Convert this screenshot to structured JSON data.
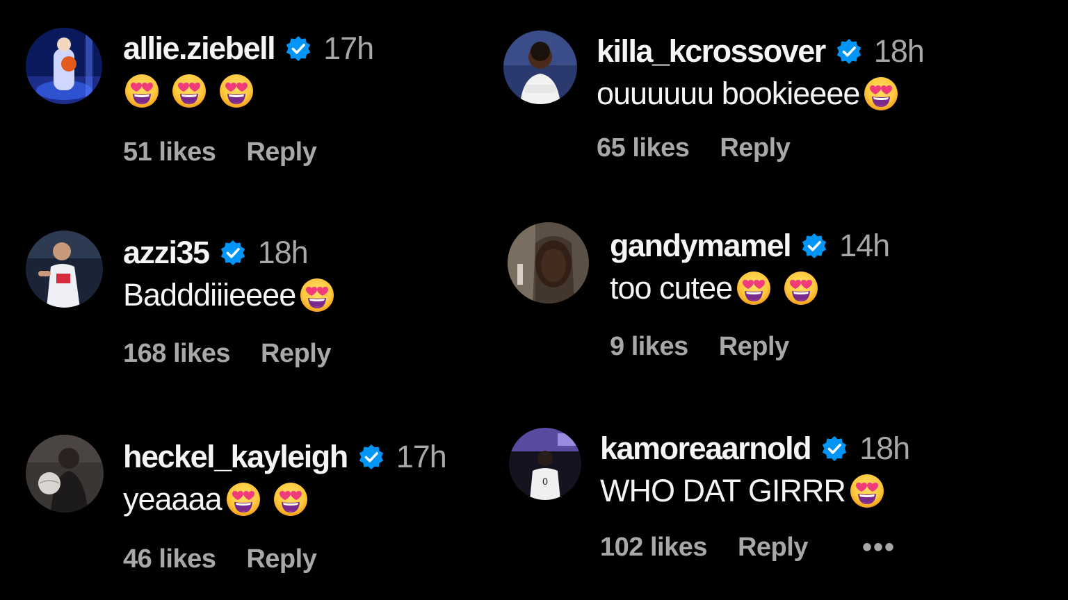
{
  "colors": {
    "background": "#000000",
    "username": "#f5f5f5",
    "muted": "#a8a8a8",
    "verified_badge": "#0095f6"
  },
  "comments": [
    {
      "username": "allie.ziebell",
      "time": "17h",
      "text": "",
      "emoji_count": 3,
      "likes": "51 likes",
      "reply": "Reply"
    },
    {
      "username": "killa_kcrossover",
      "time": "18h",
      "text": "ouuuuuu bookieeee",
      "emoji_count": 1,
      "likes": "65 likes",
      "reply": "Reply"
    },
    {
      "username": "azzi35",
      "time": "18h",
      "text": "Badddiiieeee",
      "emoji_count": 1,
      "likes": "168 likes",
      "reply": "Reply"
    },
    {
      "username": "gandymamel",
      "time": "14h",
      "text": "too cutee",
      "emoji_count": 2,
      "likes": "9 likes",
      "reply": "Reply"
    },
    {
      "username": "heckel_kayleigh",
      "time": "17h",
      "text": "yeaaaa",
      "emoji_count": 2,
      "likes": "46 likes",
      "reply": "Reply"
    },
    {
      "username": "kamoreaarnold",
      "time": "18h",
      "text": "WHO DAT GIRRR",
      "emoji_count": 1,
      "likes": "102 likes",
      "reply": "Reply",
      "more": "•••"
    }
  ],
  "icons": {
    "verified": "verified-badge-icon",
    "emoji": "heart-eyes-emoji-icon",
    "more": "more-options-icon"
  }
}
